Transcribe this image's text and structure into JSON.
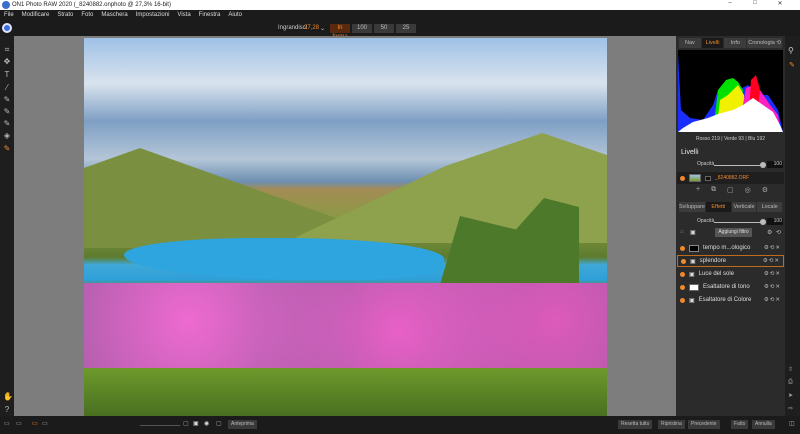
{
  "window": {
    "title": "ON1 Photo RAW 2020 (_8240882.onphoto @ 27,3% 16-bit)",
    "minimize": "–",
    "maximize": "□",
    "close": "✕"
  },
  "menu": [
    "File",
    "Modificare",
    "Strato",
    "Foto",
    "Maschera",
    "Impostazioni",
    "Vista",
    "Finestra",
    "Aiuto"
  ],
  "toolbar": {
    "zoom_label": "Ingrandisci",
    "zoom_value": "27,28",
    "fit": "In forma",
    "z100": "100",
    "z50": "50",
    "z25": "25"
  },
  "panel": {
    "tabs": [
      "Nav",
      "Livelli",
      "Info",
      "Cronologia ⟲"
    ],
    "active_tab": "Livelli",
    "rgb_readout": "Rosso 219 | Verde 93 | Blu 192",
    "layers_title": "Livelli",
    "opacity_label": "Opacità",
    "layer_opacity": "100",
    "layer_opacity_fraction": 1.0,
    "layer_name": "_8240882.ORF",
    "module_tabs": [
      "Sviluppare",
      "Effetti",
      "Verticale",
      "Locale"
    ],
    "active_module": "Effetti",
    "effects_opacity": "100",
    "add_filter": "Aggiungi filtro",
    "filters": [
      {
        "name": "tempo m...ologico",
        "selected": false
      },
      {
        "name": "splendore",
        "selected": true
      },
      {
        "name": "Luce del sole",
        "selected": false
      },
      {
        "name": "Esaltatore di tono",
        "selected": false
      },
      {
        "name": "Esaltatore di Colore",
        "selected": false
      }
    ]
  },
  "bottom": {
    "preview": "Anteprima",
    "reset_all": "Resetta tutto",
    "restore": "Ripristina",
    "previous": "Precedente",
    "done": "Fatto",
    "cancel": "Annulla"
  },
  "colors": {
    "accent": "#f08a2c",
    "panel": "#2b2b2b",
    "canvas": "#7d7d7d"
  }
}
